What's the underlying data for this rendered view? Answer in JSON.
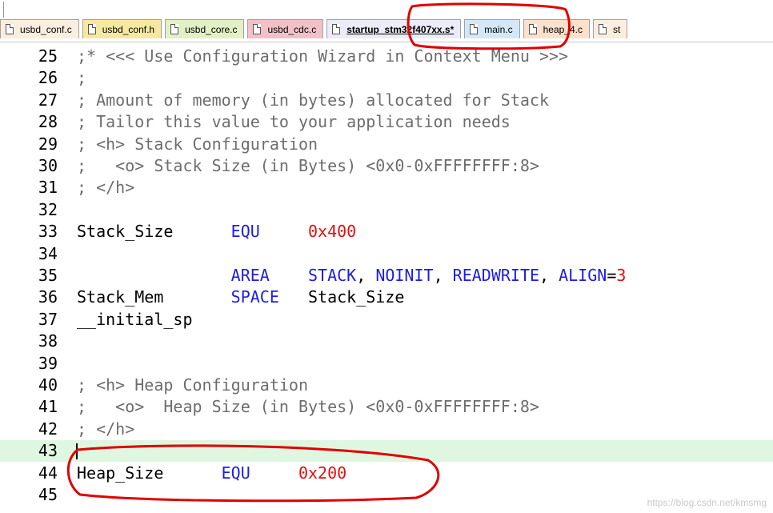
{
  "tabs": [
    {
      "label": "usbd_conf.c",
      "color": "#fbeede",
      "active": false
    },
    {
      "label": "usbd_conf.h",
      "color": "#f7e8a0",
      "active": false
    },
    {
      "label": "usbd_core.c",
      "color": "#e3f0c6",
      "active": false
    },
    {
      "label": "usbd_cdc.c",
      "color": "#f2c1c7",
      "active": false
    },
    {
      "label": "startup_stm32f407xx.s*",
      "color": "#ececf8",
      "active": true
    },
    {
      "label": "main.c",
      "color": "#d4e7f6",
      "active": false
    },
    {
      "label": "heap_4.c",
      "color": "#fbe0cb",
      "active": false
    },
    {
      "label": "st",
      "color": "#fbeede",
      "active": false
    }
  ],
  "lines": [
    {
      "n": "25",
      "tokens": [
        {
          "t": ";* <<< Use Configuration Wizard in Context Menu >>>",
          "c": "cm"
        }
      ]
    },
    {
      "n": "26",
      "tokens": [
        {
          "t": ";",
          "c": "cm"
        }
      ]
    },
    {
      "n": "27",
      "tokens": [
        {
          "t": "; Amount of memory (in bytes) allocated for Stack",
          "c": "cm"
        }
      ]
    },
    {
      "n": "28",
      "tokens": [
        {
          "t": "; Tailor this value to your application needs",
          "c": "cm"
        }
      ]
    },
    {
      "n": "29",
      "tokens": [
        {
          "t": "; <h> Stack Configuration",
          "c": "cm"
        }
      ]
    },
    {
      "n": "30",
      "tokens": [
        {
          "t": ";   <o> Stack Size (in Bytes) <0x0-0xFFFFFFFF:8>",
          "c": "cm"
        }
      ]
    },
    {
      "n": "31",
      "tokens": [
        {
          "t": "; </h>",
          "c": "cm"
        }
      ]
    },
    {
      "n": "32",
      "tokens": []
    },
    {
      "n": "33",
      "tokens": [
        {
          "t": "Stack_Size      ",
          "c": "id"
        },
        {
          "t": "EQU",
          "c": "kw"
        },
        {
          "t": "     ",
          "c": "id"
        },
        {
          "t": "0x400",
          "c": "num"
        }
      ]
    },
    {
      "n": "34",
      "tokens": []
    },
    {
      "n": "35",
      "tokens": [
        {
          "t": "                ",
          "c": "id"
        },
        {
          "t": "AREA",
          "c": "kw"
        },
        {
          "t": "    ",
          "c": "id"
        },
        {
          "t": "STACK",
          "c": "kw"
        },
        {
          "t": ", ",
          "c": "id"
        },
        {
          "t": "NOINIT",
          "c": "kw"
        },
        {
          "t": ", ",
          "c": "id"
        },
        {
          "t": "READWRITE",
          "c": "kw"
        },
        {
          "t": ", ",
          "c": "id"
        },
        {
          "t": "ALIGN",
          "c": "kw"
        },
        {
          "t": "=",
          "c": "id"
        },
        {
          "t": "3",
          "c": "num"
        }
      ]
    },
    {
      "n": "36",
      "tokens": [
        {
          "t": "Stack_Mem       ",
          "c": "id"
        },
        {
          "t": "SPACE",
          "c": "kw"
        },
        {
          "t": "   ",
          "c": "id"
        },
        {
          "t": "Stack_Size",
          "c": "id"
        }
      ]
    },
    {
      "n": "37",
      "tokens": [
        {
          "t": "__initial_sp",
          "c": "id"
        }
      ]
    },
    {
      "n": "38",
      "tokens": []
    },
    {
      "n": "39",
      "tokens": []
    },
    {
      "n": "40",
      "tokens": [
        {
          "t": "; <h> Heap Configuration",
          "c": "cm"
        }
      ]
    },
    {
      "n": "41",
      "tokens": [
        {
          "t": ";   <o>  Heap Size (in Bytes) <0x0-0xFFFFFFFF:8>",
          "c": "cm"
        }
      ]
    },
    {
      "n": "42",
      "tokens": [
        {
          "t": "; </h>",
          "c": "cm"
        }
      ]
    },
    {
      "n": "43",
      "tokens": [],
      "current": true
    },
    {
      "n": "44",
      "tokens": [
        {
          "t": "Heap_Size      ",
          "c": "id"
        },
        {
          "t": "EQU",
          "c": "kw"
        },
        {
          "t": "     ",
          "c": "id"
        },
        {
          "t": "0x200",
          "c": "num"
        }
      ]
    },
    {
      "n": "45",
      "tokens": []
    }
  ],
  "annotation_color": "#e00000",
  "watermark": "https://blog.csdn.net/kmsmg"
}
